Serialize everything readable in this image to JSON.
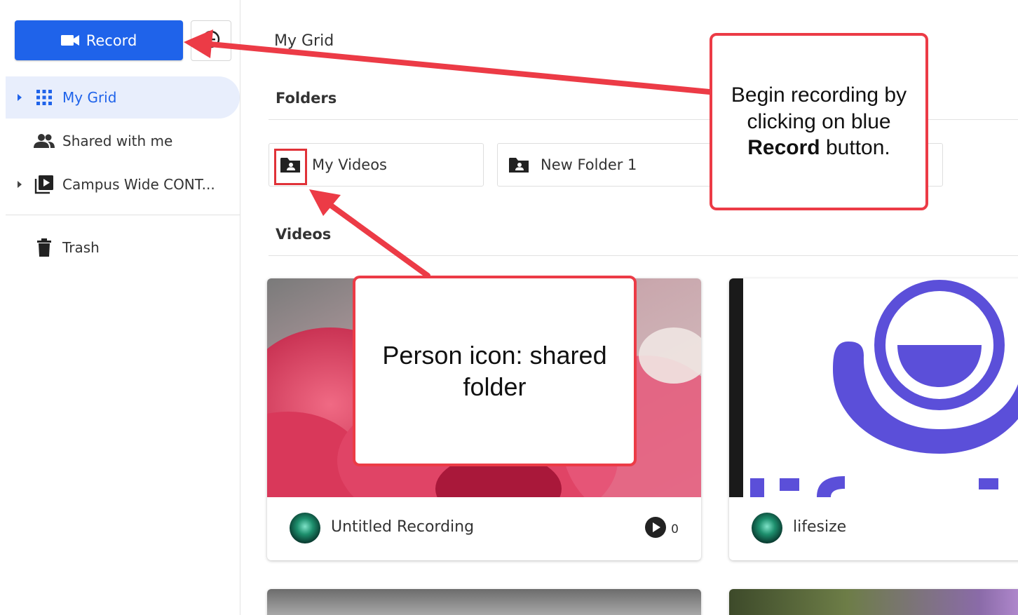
{
  "sidebar": {
    "record_label": "Record",
    "nav": [
      {
        "label": "My Grid",
        "icon": "grid-icon"
      },
      {
        "label": "Shared with me",
        "icon": "people-icon"
      },
      {
        "label": "Campus Wide CONT...",
        "icon": "video-library-icon"
      }
    ],
    "trash_label": "Trash"
  },
  "main": {
    "page_title": "My Grid",
    "folders_heading": "Folders",
    "folders": [
      {
        "name": "My Videos",
        "icon": "shared-folder-icon"
      },
      {
        "name": "New Folder 1",
        "icon": "shared-folder-icon"
      }
    ],
    "videos_heading": "Videos",
    "videos": [
      {
        "title": "Untitled Recording",
        "views": "0"
      },
      {
        "title": "lifesize"
      }
    ]
  },
  "annotations": {
    "record_callout_prefix": "Begin recording by clicking on blue",
    "record_callout_bold": "Record",
    "record_callout_suffix": "button.",
    "person_callout": "Person icon: shared folder"
  },
  "colors": {
    "primary": "#1f63ea",
    "active_bg": "#e8eefc",
    "annotation_red": "#ec3b46",
    "lifesize_purple": "#5b4fd9"
  }
}
